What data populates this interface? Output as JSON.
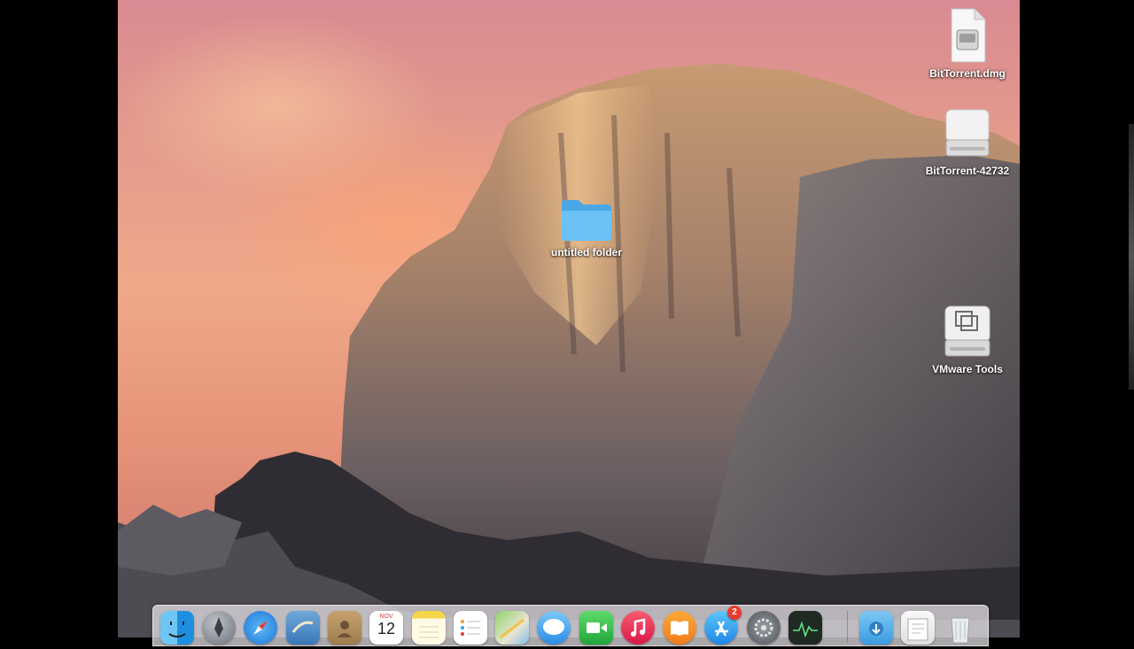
{
  "desktop": {
    "icons": [
      {
        "label": "BitTorrent.dmg",
        "icon": "dmg-file-icon"
      },
      {
        "label": "BitTorrent-42732",
        "icon": "mounted-disk-icon"
      },
      {
        "label": "untitled folder",
        "icon": "folder-icon"
      },
      {
        "label": "VMware Tools",
        "icon": "vmware-disk-icon"
      }
    ]
  },
  "dock": {
    "apps": [
      {
        "name": "Finder",
        "icon": "finder-icon"
      },
      {
        "name": "Launchpad",
        "icon": "launchpad-icon"
      },
      {
        "name": "Safari",
        "icon": "safari-icon"
      },
      {
        "name": "Mail",
        "icon": "mail-icon"
      },
      {
        "name": "Contacts",
        "icon": "contacts-icon"
      },
      {
        "name": "Calendar",
        "icon": "calendar-icon"
      },
      {
        "name": "Notes",
        "icon": "notes-icon"
      },
      {
        "name": "Reminders",
        "icon": "reminders-icon"
      },
      {
        "name": "Maps",
        "icon": "maps-icon"
      },
      {
        "name": "Messages",
        "icon": "messages-icon"
      },
      {
        "name": "FaceTime",
        "icon": "facetime-icon"
      },
      {
        "name": "iTunes",
        "icon": "itunes-icon"
      },
      {
        "name": "iBooks",
        "icon": "ibooks-icon"
      },
      {
        "name": "App Store",
        "icon": "app-store-icon"
      },
      {
        "name": "System Preferences",
        "icon": "system-preferences-icon"
      },
      {
        "name": "Activity Monitor",
        "icon": "activity-monitor-icon"
      },
      {
        "name": "Downloads",
        "icon": "downloads-stack-icon"
      },
      {
        "name": "Documents",
        "icon": "documents-stack-icon"
      },
      {
        "name": "Trash",
        "icon": "trash-icon"
      }
    ],
    "calendar": {
      "month": "NOV",
      "day": "12"
    },
    "app_store_badge": "2"
  },
  "colors": {
    "sky_top": "#d98a92",
    "sky_mid": "#f0a88a",
    "rock_light": "#c79a72",
    "rock_dark": "#4a4448",
    "folder_blue": "#5ab4ef",
    "dock_bg": "#ebe8ec"
  }
}
